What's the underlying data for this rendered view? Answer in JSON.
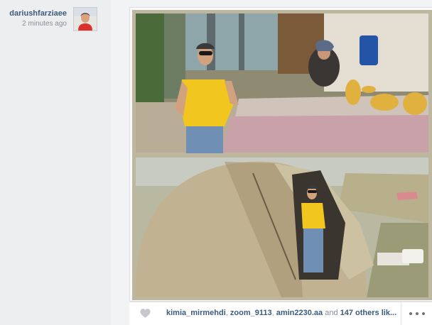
{
  "post": {
    "username": "dariushfarziaee",
    "timestamp": "2 minutes ago",
    "avatar_alt": "profile photo"
  },
  "photo": {
    "top_scene": "man in yellow t-shirt and sunglasses next to woman baking flatbread",
    "bottom_scene": "man in yellow t-shirt standing at entrance of felt yurt"
  },
  "likes": {
    "users": [
      "kimia_mirmehdi",
      "zoom_9113",
      "amin2230.aa"
    ],
    "sep": ", ",
    "and": "and",
    "others": "147 others lik..."
  },
  "icons": {
    "heart": "heart-icon",
    "more": "more-options-icon"
  },
  "colors": {
    "username": "#3b5b7b",
    "secondary_text": "#8a8f96",
    "heart": "#c6c8cb"
  }
}
